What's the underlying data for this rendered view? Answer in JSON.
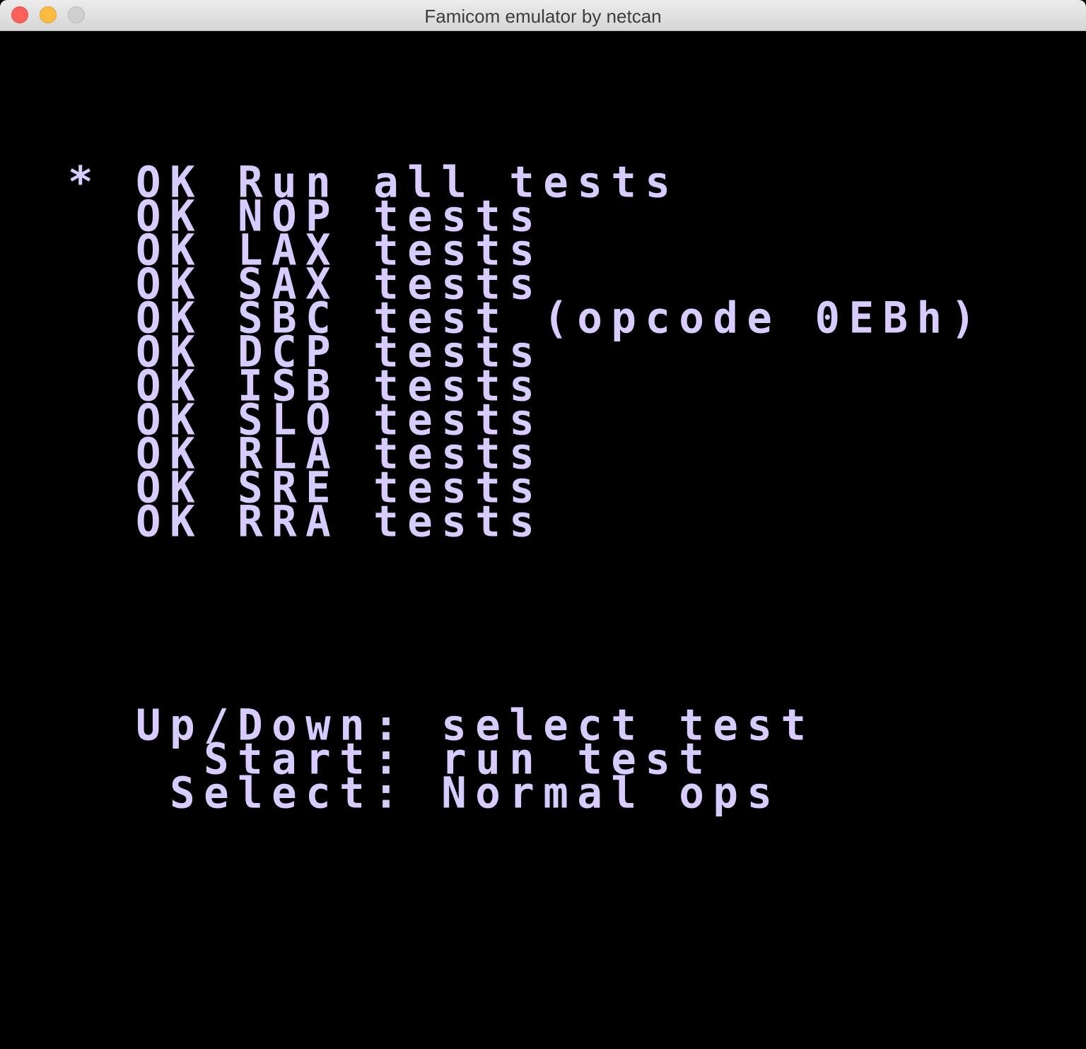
{
  "window": {
    "title": "Famicom emulator by netcan"
  },
  "screen": {
    "menu_lines": [
      "* OK Run all tests",
      "  OK NOP tests",
      "  OK LAX tests",
      "  OK SAX tests",
      "  OK SBC test (opcode 0EBh)",
      "  OK DCP tests",
      "  OK ISB tests",
      "  OK SLO tests",
      "  OK RLA tests",
      "  OK SRE tests",
      "  OK RRA tests"
    ],
    "help_lines": [
      "  Up/Down: select test",
      "    Start: run test",
      "   Select: Normal ops"
    ]
  },
  "colors": {
    "background": "#000000",
    "text": "#d8ccff"
  }
}
